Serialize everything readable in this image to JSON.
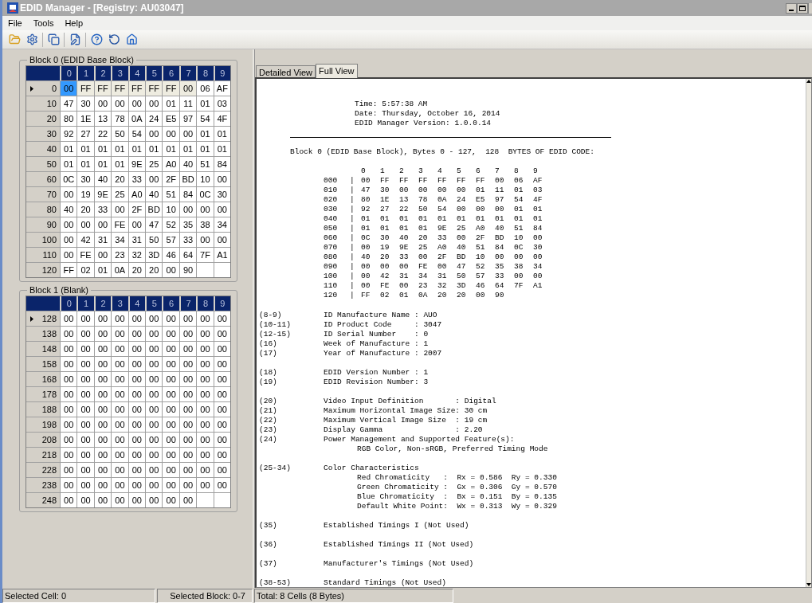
{
  "window": {
    "title": "EDID Manager - [Registry: AU03047]"
  },
  "menu": [
    "File",
    "Tools",
    "Help"
  ],
  "grids": [
    {
      "title": "Block 0 (EDID Base Block)",
      "columns": [
        "0",
        "1",
        "2",
        "3",
        "4",
        "5",
        "6",
        "7",
        "8",
        "9"
      ],
      "rows": [
        {
          "label": "0",
          "current": true,
          "cells": [
            {
              "value": "00",
              "selected": true
            },
            {
              "value": "FF",
              "selected": false,
              "highlighted": true
            },
            {
              "value": "FF",
              "selected": false,
              "highlighted": true
            },
            {
              "value": "FF",
              "selected": false,
              "highlighted": true
            },
            {
              "value": "FF",
              "selected": false,
              "highlighted": true
            },
            {
              "value": "FF",
              "selected": false,
              "highlighted": true
            },
            {
              "value": "FF",
              "selected": false,
              "highlighted": true
            },
            {
              "value": "00",
              "selected": false,
              "highlighted": true
            },
            {
              "value": "06",
              "selected": false,
              "highlighted": false
            },
            {
              "value": "AF",
              "selected": false,
              "highlighted": false
            }
          ]
        },
        {
          "label": "10",
          "current": false,
          "cells": [
            "47",
            "30",
            "00",
            "00",
            "00",
            "00",
            "01",
            "11",
            "01",
            "03"
          ]
        },
        {
          "label": "20",
          "current": false,
          "cells": [
            "80",
            "1E",
            "13",
            "78",
            "0A",
            "24",
            "E5",
            "97",
            "54",
            "4F"
          ]
        },
        {
          "label": "30",
          "current": false,
          "cells": [
            "92",
            "27",
            "22",
            "50",
            "54",
            "00",
            "00",
            "00",
            "01",
            "01"
          ]
        },
        {
          "label": "40",
          "current": false,
          "cells": [
            "01",
            "01",
            "01",
            "01",
            "01",
            "01",
            "01",
            "01",
            "01",
            "01"
          ]
        },
        {
          "label": "50",
          "current": false,
          "cells": [
            "01",
            "01",
            "01",
            "01",
            "9E",
            "25",
            "A0",
            "40",
            "51",
            "84"
          ]
        },
        {
          "label": "60",
          "current": false,
          "cells": [
            "0C",
            "30",
            "40",
            "20",
            "33",
            "00",
            "2F",
            "BD",
            "10",
            "00"
          ]
        },
        {
          "label": "70",
          "current": false,
          "cells": [
            "00",
            "19",
            "9E",
            "25",
            "A0",
            "40",
            "51",
            "84",
            "0C",
            "30"
          ]
        },
        {
          "label": "80",
          "current": false,
          "cells": [
            "40",
            "20",
            "33",
            "00",
            "2F",
            "BD",
            "10",
            "00",
            "00",
            "00"
          ]
        },
        {
          "label": "90",
          "current": false,
          "cells": [
            "00",
            "00",
            "00",
            "FE",
            "00",
            "47",
            "52",
            "35",
            "38",
            "34"
          ]
        },
        {
          "label": "100",
          "current": false,
          "cells": [
            "00",
            "42",
            "31",
            "34",
            "31",
            "50",
            "57",
            "33",
            "00",
            "00"
          ]
        },
        {
          "label": "110",
          "current": false,
          "cells": [
            "00",
            "FE",
            "00",
            "23",
            "32",
            "3D",
            "46",
            "64",
            "7F",
            "A1"
          ]
        },
        {
          "label": "120",
          "current": false,
          "cells": [
            "FF",
            "02",
            "01",
            "0A",
            "20",
            "20",
            "00",
            "90"
          ]
        }
      ]
    },
    {
      "title": "Block 1 (Blank)",
      "columns": [
        "0",
        "1",
        "2",
        "3",
        "4",
        "5",
        "6",
        "7",
        "8",
        "9"
      ],
      "rows": [
        {
          "label": "128",
          "current": true,
          "cells": [
            "00",
            "00",
            "00",
            "00",
            "00",
            "00",
            "00",
            "00",
            "00",
            "00"
          ]
        },
        {
          "label": "138",
          "current": false,
          "cells": [
            "00",
            "00",
            "00",
            "00",
            "00",
            "00",
            "00",
            "00",
            "00",
            "00"
          ]
        },
        {
          "label": "148",
          "current": false,
          "cells": [
            "00",
            "00",
            "00",
            "00",
            "00",
            "00",
            "00",
            "00",
            "00",
            "00"
          ]
        },
        {
          "label": "158",
          "current": false,
          "cells": [
            "00",
            "00",
            "00",
            "00",
            "00",
            "00",
            "00",
            "00",
            "00",
            "00"
          ]
        },
        {
          "label": "168",
          "current": false,
          "cells": [
            "00",
            "00",
            "00",
            "00",
            "00",
            "00",
            "00",
            "00",
            "00",
            "00"
          ]
        },
        {
          "label": "178",
          "current": false,
          "cells": [
            "00",
            "00",
            "00",
            "00",
            "00",
            "00",
            "00",
            "00",
            "00",
            "00"
          ]
        },
        {
          "label": "188",
          "current": false,
          "cells": [
            "00",
            "00",
            "00",
            "00",
            "00",
            "00",
            "00",
            "00",
            "00",
            "00"
          ]
        },
        {
          "label": "198",
          "current": false,
          "cells": [
            "00",
            "00",
            "00",
            "00",
            "00",
            "00",
            "00",
            "00",
            "00",
            "00"
          ]
        },
        {
          "label": "208",
          "current": false,
          "cells": [
            "00",
            "00",
            "00",
            "00",
            "00",
            "00",
            "00",
            "00",
            "00",
            "00"
          ]
        },
        {
          "label": "218",
          "current": false,
          "cells": [
            "00",
            "00",
            "00",
            "00",
            "00",
            "00",
            "00",
            "00",
            "00",
            "00"
          ]
        },
        {
          "label": "228",
          "current": false,
          "cells": [
            "00",
            "00",
            "00",
            "00",
            "00",
            "00",
            "00",
            "00",
            "00",
            "00"
          ]
        },
        {
          "label": "238",
          "current": false,
          "cells": [
            "00",
            "00",
            "00",
            "00",
            "00",
            "00",
            "00",
            "00",
            "00",
            "00"
          ]
        },
        {
          "label": "248",
          "current": false,
          "cells": [
            "00",
            "00",
            "00",
            "00",
            "00",
            "00",
            "00",
            "00"
          ]
        }
      ]
    }
  ],
  "tabs": [
    {
      "label": "Detailed View",
      "selected": false
    },
    {
      "label": "Full View",
      "selected": true
    }
  ],
  "full_view": {
    "header": [
      "Time: 5:57:38 AM",
      "Date: Thursday, October 16, 2014",
      "EDID Manager Version: 1.0.0.14"
    ],
    "block_title": "Block 0 (EDID Base Block), Bytes 0 - 127,  128  BYTES OF EDID CODE:",
    "hex_columns": [
      "0",
      "1",
      "2",
      "3",
      "4",
      "5",
      "6",
      "7",
      "8",
      "9"
    ],
    "hex_rows": [
      {
        "address": "000",
        "separator": "|",
        "bytes": [
          "00",
          "FF",
          "FF",
          "FF",
          "FF",
          "FF",
          "FF",
          "00",
          "06",
          "AF"
        ]
      },
      {
        "address": "010",
        "separator": "|",
        "bytes": [
          "47",
          "30",
          "00",
          "00",
          "00",
          "00",
          "01",
          "11",
          "01",
          "03"
        ]
      },
      {
        "address": "020",
        "separator": "|",
        "bytes": [
          "80",
          "1E",
          "13",
          "78",
          "0A",
          "24",
          "E5",
          "97",
          "54",
          "4F"
        ]
      },
      {
        "address": "030",
        "separator": "|",
        "bytes": [
          "92",
          "27",
          "22",
          "50",
          "54",
          "00",
          "00",
          "00",
          "01",
          "01"
        ]
      },
      {
        "address": "040",
        "separator": "|",
        "bytes": [
          "01",
          "01",
          "01",
          "01",
          "01",
          "01",
          "01",
          "01",
          "01",
          "01"
        ]
      },
      {
        "address": "050",
        "separator": "|",
        "bytes": [
          "01",
          "01",
          "01",
          "01",
          "9E",
          "25",
          "A0",
          "40",
          "51",
          "84"
        ]
      },
      {
        "address": "060",
        "separator": "|",
        "bytes": [
          "0C",
          "30",
          "40",
          "20",
          "33",
          "00",
          "2F",
          "BD",
          "10",
          "00"
        ]
      },
      {
        "address": "070",
        "separator": "|",
        "bytes": [
          "00",
          "19",
          "9E",
          "25",
          "A0",
          "40",
          "51",
          "84",
          "0C",
          "30"
        ]
      },
      {
        "address": "080",
        "separator": "|",
        "bytes": [
          "40",
          "20",
          "33",
          "00",
          "2F",
          "BD",
          "10",
          "00",
          "00",
          "00"
        ]
      },
      {
        "address": "090",
        "separator": "|",
        "bytes": [
          "00",
          "00",
          "00",
          "FE",
          "00",
          "47",
          "52",
          "35",
          "38",
          "34"
        ]
      },
      {
        "address": "100",
        "separator": "|",
        "bytes": [
          "00",
          "42",
          "31",
          "34",
          "31",
          "50",
          "57",
          "33",
          "00",
          "00"
        ]
      },
      {
        "address": "110",
        "separator": "|",
        "bytes": [
          "00",
          "FE",
          "00",
          "23",
          "32",
          "3D",
          "46",
          "64",
          "7F",
          "A1"
        ]
      },
      {
        "address": "120",
        "separator": "|",
        "bytes": [
          "FF",
          "02",
          "01",
          "0A",
          "20",
          "20",
          "00",
          "90"
        ]
      }
    ],
    "sections": [
      [
        {
          "kind": "field",
          "ref": "(8-9)",
          "text": "ID Manufacture Name : AUO"
        },
        {
          "kind": "field",
          "ref": "(10-11)",
          "text": "ID Product Code     : 3047"
        },
        {
          "kind": "field",
          "ref": "(12-15)",
          "text": "ID Serial Number    : 0"
        },
        {
          "kind": "field",
          "ref": "(16)",
          "text": "Week of Manufacture : 1"
        },
        {
          "kind": "field",
          "ref": "(17)",
          "text": "Year of Manufacture : 2007"
        }
      ],
      [
        {
          "kind": "field",
          "ref": "(18)",
          "text": "EDID Version Number : 1"
        },
        {
          "kind": "field",
          "ref": "(19)",
          "text": "EDID Revision Number: 3"
        }
      ],
      [
        {
          "kind": "field",
          "ref": "(20)",
          "text": "Video Input Definition       : Digital"
        },
        {
          "kind": "field",
          "ref": "(21)",
          "text": "Maximum Horizontal Image Size: 30 cm"
        },
        {
          "kind": "field",
          "ref": "(22)",
          "text": "Maximum Vertical Image Size  : 19 cm"
        },
        {
          "kind": "field",
          "ref": "(23)",
          "text": "Display Gamma                : 2.20"
        },
        {
          "kind": "field",
          "ref": "(24)",
          "text": "Power Management and Supported Feature(s):"
        },
        {
          "kind": "detail",
          "text": "RGB Color, Non-sRGB, Preferred Timing Mode"
        }
      ],
      [
        {
          "kind": "field",
          "ref": "(25-34)",
          "text": "Color Characteristics"
        },
        {
          "kind": "detail",
          "text": "Red Chromaticity   :  Rx = 0.586  Ry = 0.330"
        },
        {
          "kind": "detail",
          "text": "Green Chromaticity :  Gx = 0.306  Gy = 0.570"
        },
        {
          "kind": "detail",
          "text": "Blue Chromaticity  :  Bx = 0.151  By = 0.135"
        },
        {
          "kind": "detail",
          "text": "Default White Point:  Wx = 0.313  Wy = 0.329"
        }
      ],
      [
        {
          "kind": "field",
          "ref": "(35)",
          "text": "Established Timings I (Not Used)"
        }
      ],
      [
        {
          "kind": "field",
          "ref": "(36)",
          "text": "Established Timings II (Not Used)"
        }
      ],
      [
        {
          "kind": "field",
          "ref": "(37)",
          "text": "Manufacturer's Timings (Not Used)"
        }
      ],
      [
        {
          "kind": "field",
          "ref": "(38-53)",
          "text": "Standard Timings (Not Used)"
        }
      ]
    ]
  },
  "status_bar": [
    "Selected Cell: 0",
    "Selected Block: 0-7",
    "Total: 8 Cells (8 Bytes)"
  ]
}
